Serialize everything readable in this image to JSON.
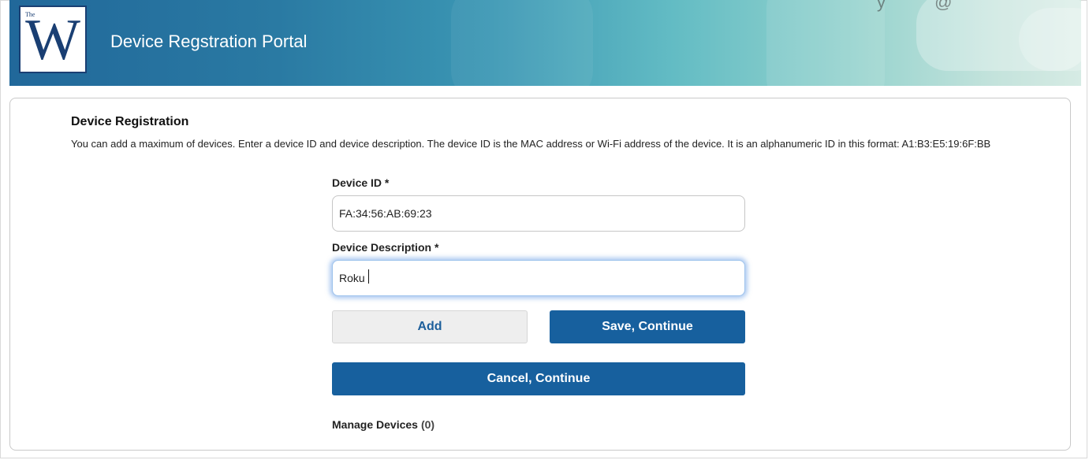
{
  "header": {
    "logo_small": "The",
    "logo_letter": "W",
    "title": "Device Regstration Portal",
    "top_right_glyphs": "y @"
  },
  "registration": {
    "heading": "Device Registration",
    "intro": "You can add a maximum of devices. Enter a device ID and device description. The device ID is the MAC address or Wi-Fi address of the device. It is an alphanumeric ID in this format: A1:B3:E5:19:6F:BB",
    "device_id": {
      "label": "Device ID *",
      "value": "FA:34:56:AB:69:23"
    },
    "device_description": {
      "label": "Device Description *",
      "value": "Roku"
    },
    "buttons": {
      "add": "Add",
      "save_continue": "Save, Continue",
      "cancel_continue": "Cancel, Continue"
    },
    "manage": {
      "label": "Manage Devices",
      "count": "(0)"
    }
  },
  "colors": {
    "primary_button": "#17609e",
    "header_start": "#21689a",
    "header_end": "#d6ebe4",
    "logo": "#1a3f73"
  }
}
